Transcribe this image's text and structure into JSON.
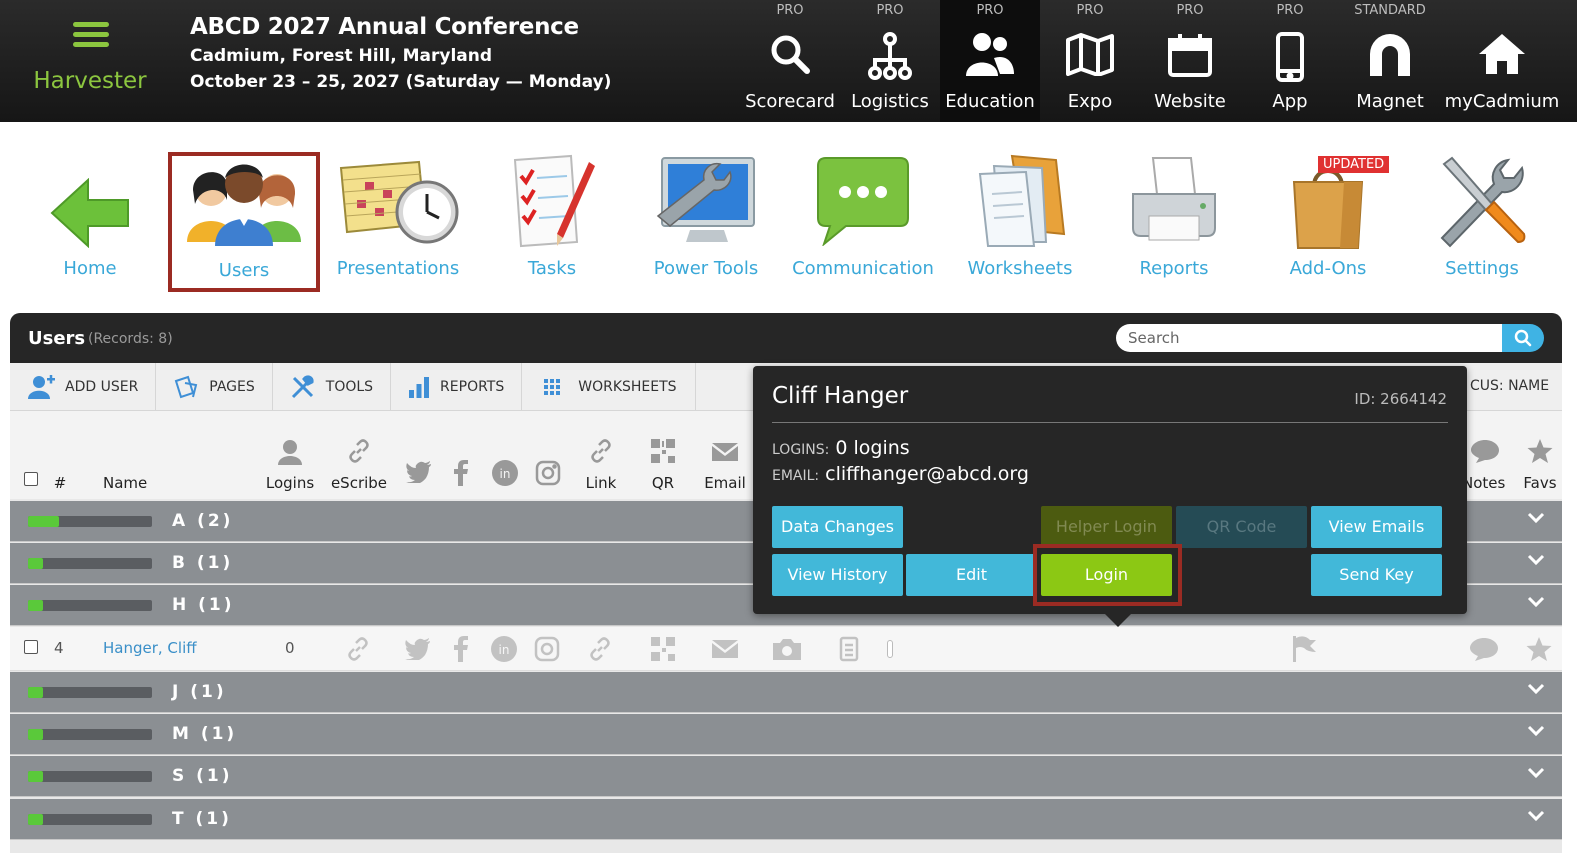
{
  "brand": {
    "name": "Harvester"
  },
  "event": {
    "title": "ABCD 2027 Annual Conference",
    "location": "Cadmium, Forest Hill, Maryland",
    "dates": "October 23 – 25, 2027 (Saturday — Monday)"
  },
  "modules": [
    {
      "tier": "PRO",
      "label": "Scorecard",
      "icon": "search-icon"
    },
    {
      "tier": "PRO",
      "label": "Logistics",
      "icon": "org-chart-icon"
    },
    {
      "tier": "PRO",
      "label": "Education",
      "icon": "people-icon",
      "active": true
    },
    {
      "tier": "PRO",
      "label": "Expo",
      "icon": "map-icon"
    },
    {
      "tier": "PRO",
      "label": "Website",
      "icon": "calendar-icon"
    },
    {
      "tier": "PRO",
      "label": "App",
      "icon": "phone-icon"
    },
    {
      "tier": "STANDARD",
      "label": "Magnet",
      "icon": "magnet-icon"
    },
    {
      "tier": "",
      "label": "myCadmium",
      "icon": "home-icon"
    }
  ],
  "nav": {
    "home": "Home",
    "users": "Users",
    "presentations": "Presentations",
    "tasks": "Tasks",
    "power_tools": "Power Tools",
    "communication": "Communication",
    "worksheets": "Worksheets",
    "reports": "Reports",
    "addons": "Add-Ons",
    "settings": "Settings",
    "addons_badge": "UPDATED"
  },
  "panel": {
    "title": "Users",
    "records": "(Records: 8)",
    "search_placeholder": "Search",
    "toolbar": {
      "add_user": "ADD USER",
      "pages": "PAGES",
      "tools": "TOOLS",
      "reports": "REPORTS",
      "worksheets": "WORKSHEETS",
      "focus": "CUS: NAME"
    },
    "columns": {
      "num": "#",
      "name": "Name",
      "logins": "Logins",
      "escribe": "eScribe",
      "link": "Link",
      "qr": "QR",
      "email": "Email",
      "notes": "Notes",
      "favs": "Favs"
    },
    "groups": [
      {
        "label": "A (2)",
        "progress": 0.25
      },
      {
        "label": "B (1)",
        "progress": 0.12
      },
      {
        "label": "H (1)",
        "progress": 0.12
      },
      {
        "label": "J (1)",
        "progress": 0.12
      },
      {
        "label": "M (1)",
        "progress": 0.12
      },
      {
        "label": "S (1)",
        "progress": 0.12
      },
      {
        "label": "T (1)",
        "progress": 0.12
      }
    ],
    "user_row": {
      "num": "4",
      "name": "Hanger, Cliff",
      "logins": "0"
    }
  },
  "popup": {
    "name": "Cliff Hanger",
    "id": "ID: 2664142",
    "logins_key": "LOGINS:",
    "logins_value": "0 logins",
    "email_key": "EMAIL:",
    "email_value": "cliffhanger@abcd.org",
    "buttons": {
      "data_changes": "Data Changes",
      "helper_login": "Helper Login",
      "qr_code": "QR Code",
      "view_emails": "View Emails",
      "view_history": "View History",
      "edit": "Edit",
      "login": "Login",
      "send_key": "Send Key"
    }
  },
  "colors": {
    "accent_green": "#8cc63f",
    "link_blue": "#3aa8d8",
    "button_blue": "#42b8d9",
    "highlight_red": "#9b2b23"
  }
}
